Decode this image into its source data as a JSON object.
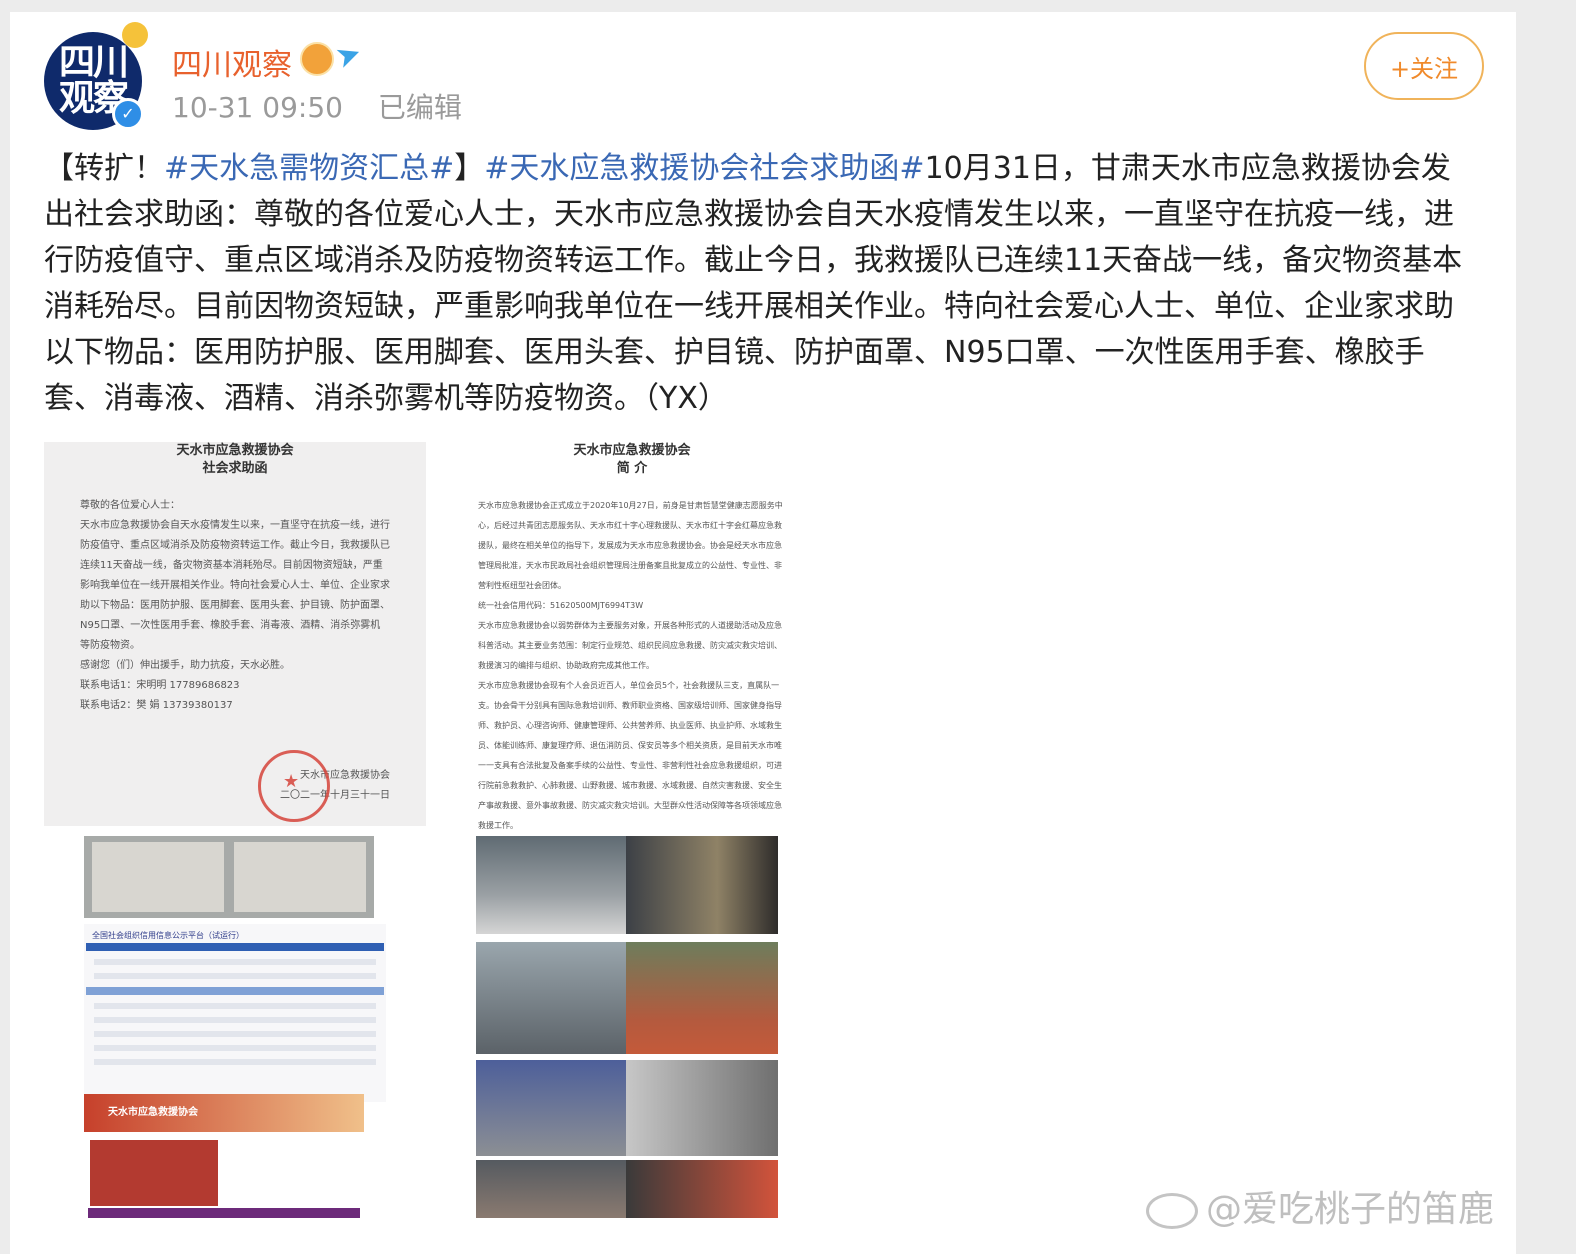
{
  "post": {
    "avatar": {
      "line1": "四川",
      "line2": "观察",
      "verified_glyph": "✓"
    },
    "username": "四川观察",
    "time": "10-31 09:50",
    "edited": "已编辑",
    "follow_label": "+关注",
    "text": {
      "prefix": "【转扩！",
      "tag1": "#天水急需物资汇总#",
      "mid": "】",
      "tag2": "#天水应急救援协会社会求助函#",
      "body": "10月31日，甘肃天水市应急救援协会发出社会求助函：尊敬的各位爱心人士，天水市应急救援协会自天水疫情发生以来，一直坚守在抗疫一线，进行防疫值守、重点区域消杀及防疫物资转运工作。截止今日，我救援队已连续11天奋战一线，备灾物资基本消耗殆尽。目前因物资短缺，严重影响我单位在一线开展相关作业。特向社会爱心人士、单位、企业家求助以下物品：医用防护服、医用脚套、医用头套、护目镜、防护面罩、N95口罩、一次性医用手套、橡胶手套、消毒液、酒精、消杀弥雾机等防疫物资。（YX）"
    }
  },
  "images": {
    "doc1": {
      "title_line1": "天水市应急救援协会",
      "title_line2": "社会求助函",
      "greeting": "尊敬的各位爱心人士：",
      "body": "天水市应急救援协会自天水疫情发生以来，一直坚守在抗疫一线，进行防疫值守、重点区域消杀及防疫物资转运工作。截止今日，我救援队已连续11天奋战一线，备灾物资基本消耗殆尽。目前因物资短缺，严重影响我单位在一线开展相关作业。特向社会爱心人士、单位、企业家求助以下物品：医用防护服、医用脚套、医用头套、护目镜、防护面罩、N95口罩、一次性医用手套、橡胶手套、消毒液、酒精、消杀弥雾机等防疫物资。",
      "thanks": "感谢您（们）伸出援手，助力抗疫，天水必胜。",
      "contact1": "联系电话1：宋明明  17789686823",
      "contact2": "联系电话2：樊  娟  13739380137",
      "sign_org": "天水市应急救援协会",
      "sign_date": "二〇二一年十月三十一日"
    },
    "doc2": {
      "title_line1": "天水市应急救援协会",
      "title_line2": "简  介",
      "p1": "天水市应急救援协会正式成立于2020年10月27日，前身是甘肃哲慧堂健康志愿服务中心，后经过共青团志愿服务队、天水市红十字心理救援队、天水市红十字会红幕应急救援队，最终在相关单位的指导下，发展成为天水市应急救援协会。协会是经天水市应急管理局批准，天水市民政局社会组织管理局注册备案且批复成立的公益性、专业性、非营利性枢纽型社会团体。",
      "p2": "统一社会信用代码：51620500MJT6994T3W",
      "p3": "天水市应急救援协会以弱势群体为主要服务对象，开展各种形式的人道援助活动及应急科普活动。其主要业务范围：制定行业规范、组织民间应急救援、防灾减灾救灾培训、救援演习的编排与组织、协助政府完成其他工作。",
      "p4": "天水市应急救援协会现有个人会员近百人，单位会员5个，社会救援队三支，直属队一支。协会骨干分别具有国际急救培训师、教师职业资格、国家级培训师、国家健身指导师、救护员、心理咨询师、健康管理师、公共营养师、执业医师、执业护师、水域救生员、体能训练师、康复理疗师、退伍消防员、保安员等多个相关资质，是目前天水市唯一一支具有合法批复及备案手续的公益性、专业性、非营利性社会应急救援组织，可进行院前急救救护、心肺救援、山野救援、城市救援、水域救援、自然灾害救援、安全生产事故救援、意外事故救援、防灾减灾救灾培训。大型群众性活动保障等各项领域应急救援工作。"
    },
    "web": {
      "title": "全国社会组织信用信息公示平台（试运行）"
    },
    "banner": {
      "title": "天水市应急救援协会"
    }
  },
  "watermark": {
    "text": "@爱吃桃子的笛鹿"
  },
  "colors": {
    "username": "#e8612d",
    "hashtag": "#3a68b4",
    "follow": "#f08a2b",
    "meta": "#9a9a9a"
  }
}
